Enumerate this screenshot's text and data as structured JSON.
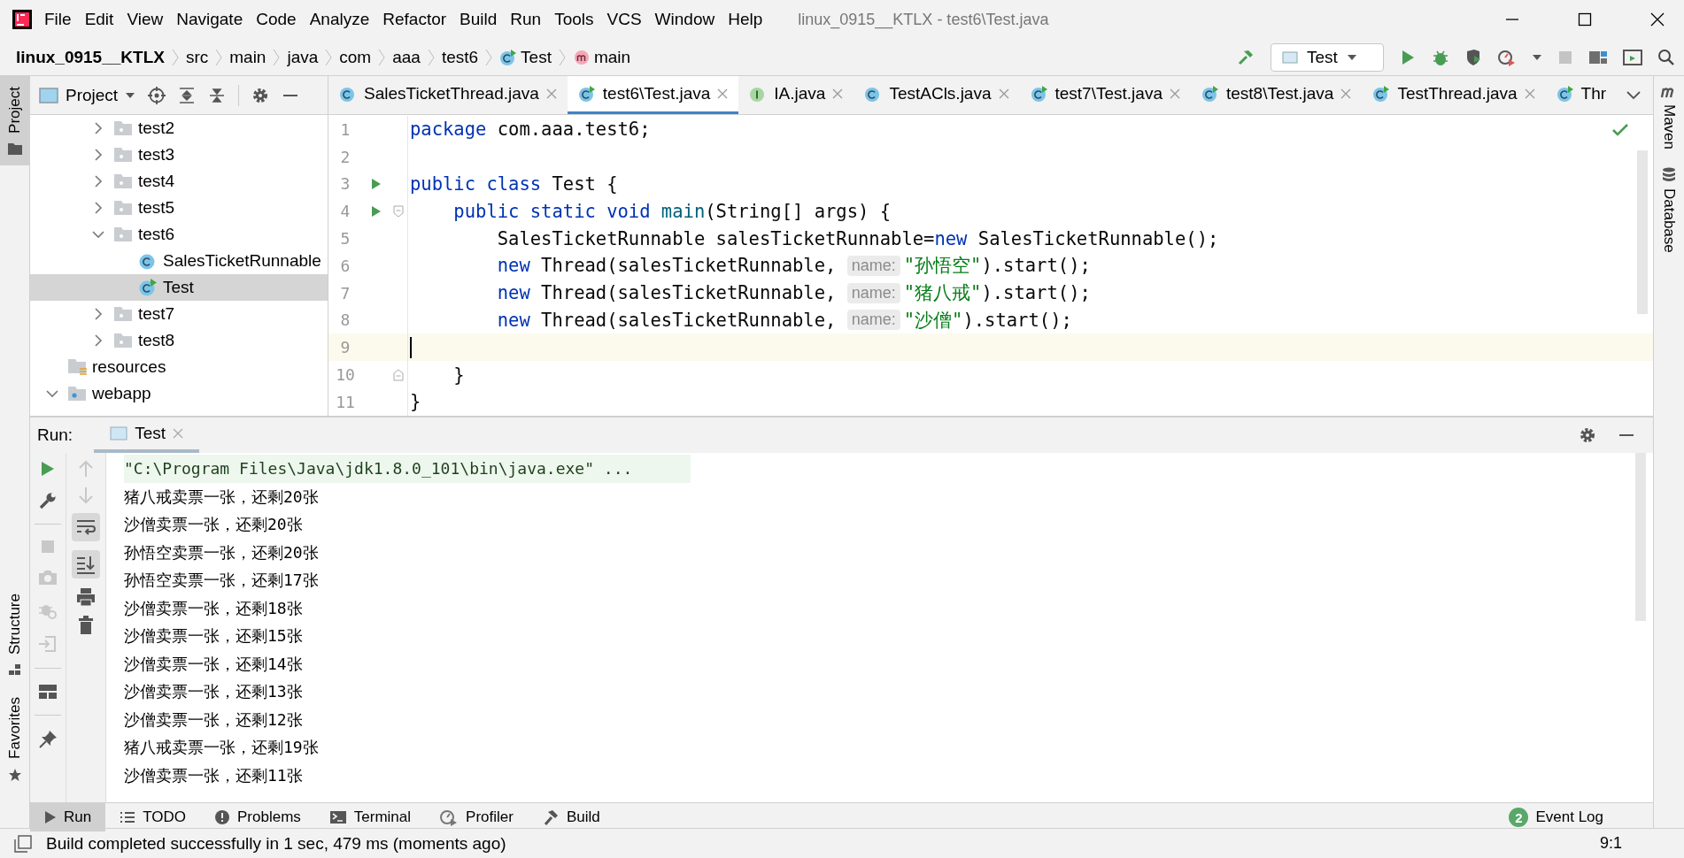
{
  "window": {
    "title": "linux_0915__KTLX - test6\\Test.java"
  },
  "menu": [
    "File",
    "Edit",
    "View",
    "Navigate",
    "Code",
    "Analyze",
    "Refactor",
    "Build",
    "Run",
    "Tools",
    "VCS",
    "Window",
    "Help"
  ],
  "breadcrumbs": [
    {
      "label": "linux_0915__KTLX",
      "kind": "project"
    },
    {
      "label": "src",
      "kind": "folder"
    },
    {
      "label": "main",
      "kind": "folder"
    },
    {
      "label": "java",
      "kind": "folder"
    },
    {
      "label": "com",
      "kind": "folder"
    },
    {
      "label": "aaa",
      "kind": "folder"
    },
    {
      "label": "test6",
      "kind": "folder"
    },
    {
      "label": "Test",
      "kind": "class"
    },
    {
      "label": "main",
      "kind": "method"
    }
  ],
  "run_config": {
    "label": "Test"
  },
  "left_stripe": [
    {
      "label": "Project",
      "kind": "project",
      "selected": true
    },
    {
      "label": "Structure",
      "kind": "structure",
      "selected": false
    },
    {
      "label": "Favorites",
      "kind": "favorites",
      "selected": false
    }
  ],
  "right_stripe": [
    {
      "label": "Maven",
      "kind": "maven"
    },
    {
      "label": "Database",
      "kind": "database"
    }
  ],
  "project": {
    "title": "Project",
    "tree": [
      {
        "children": [
          {
            "label": "test2",
            "kind": "folder",
            "expanded": false,
            "selected": false
          },
          {
            "label": "test3",
            "kind": "folder",
            "expanded": false,
            "selected": false
          },
          {
            "label": "test4",
            "kind": "folder",
            "expanded": false,
            "selected": false
          },
          {
            "label": "test5",
            "kind": "folder",
            "expanded": false,
            "selected": false
          },
          {
            "label": "test6",
            "kind": "folder",
            "expanded": true,
            "selected": false,
            "children": [
              {
                "label": "SalesTicketRunnable",
                "kind": "class",
                "selected": false
              },
              {
                "label": "Test",
                "kind": "runnable",
                "selected": true
              }
            ]
          },
          {
            "label": "test7",
            "kind": "folder",
            "expanded": false,
            "selected": false
          },
          {
            "label": "test8",
            "kind": "folder",
            "expanded": false,
            "selected": false
          }
        ]
      },
      {
        "label": "resources",
        "kind": "resources",
        "selected": false
      },
      {
        "label": "webapp",
        "kind": "webapp",
        "expanded": true,
        "selected": false
      }
    ]
  },
  "editor_tabs": [
    {
      "label": "SalesTicketThread.java",
      "kind": "class",
      "selected": false,
      "close_button": true
    },
    {
      "label": "test6\\Test.java",
      "kind": "runnable",
      "selected": true,
      "close_button": true
    },
    {
      "label": "IA.java",
      "kind": "interface",
      "selected": false,
      "close_button": true
    },
    {
      "label": "TestACls.java",
      "kind": "class",
      "selected": false,
      "close_button": true
    },
    {
      "label": "test7\\Test.java",
      "kind": "runnable",
      "selected": false,
      "close_button": true
    },
    {
      "label": "test8\\Test.java",
      "kind": "runnable",
      "selected": false,
      "close_button": true
    },
    {
      "label": "TestThread.java",
      "kind": "runnable",
      "selected": false,
      "close_button": true
    },
    {
      "label": "Thr",
      "kind": "runnable",
      "selected": false,
      "close_button": false
    }
  ],
  "code_lines": [
    {
      "number": "1",
      "segments": [
        {
          "kind": "kw",
          "text": "package"
        },
        {
          "kind": "plain",
          "text": " com.aaa.test6;"
        }
      ]
    },
    {
      "number": "2"
    },
    {
      "number": "3",
      "gutter": [
        {
          "kind": "run"
        }
      ],
      "segments": [
        {
          "kind": "kw",
          "text": "public class"
        },
        {
          "kind": "plain",
          "text": " Test {"
        }
      ]
    },
    {
      "number": "4",
      "gutter": [
        {
          "kind": "run"
        },
        {
          "kind": "fold-start"
        }
      ],
      "segments": [
        {
          "kind": "kw",
          "text": "    public static void"
        },
        {
          "kind": "fn",
          "text": " main"
        },
        {
          "kind": "plain",
          "text": "(String[] args) {"
        }
      ]
    },
    {
      "number": "5",
      "segments": [
        {
          "kind": "plain",
          "text": "        SalesTicketRunnable salesTicketRunnable="
        },
        {
          "kind": "kw",
          "text": "new"
        },
        {
          "kind": "plain",
          "text": " SalesTicketRunnable();"
        }
      ]
    },
    {
      "number": "6",
      "segments": [
        {
          "kind": "kw",
          "text": "        new"
        },
        {
          "kind": "plain",
          "text": " Thread(salesTicketRunnable, "
        },
        {
          "kind": "hint",
          "text": "name:"
        },
        {
          "kind": "str",
          "text": "\"孙悟空\""
        },
        {
          "kind": "plain",
          "text": ").start();"
        }
      ]
    },
    {
      "number": "7",
      "segments": [
        {
          "kind": "kw",
          "text": "        new"
        },
        {
          "kind": "plain",
          "text": " Thread(salesTicketRunnable, "
        },
        {
          "kind": "hint",
          "text": "name:"
        },
        {
          "kind": "str",
          "text": "\"猪八戒\""
        },
        {
          "kind": "plain",
          "text": ").start();"
        }
      ]
    },
    {
      "number": "8",
      "segments": [
        {
          "kind": "kw",
          "text": "        new"
        },
        {
          "kind": "plain",
          "text": " Thread(salesTicketRunnable, "
        },
        {
          "kind": "hint",
          "text": "name:"
        },
        {
          "kind": "str",
          "text": "\"沙僧\""
        },
        {
          "kind": "plain",
          "text": ").start();"
        }
      ]
    },
    {
      "number": "9",
      "current": true
    },
    {
      "number": "10",
      "gutter": [
        {
          "kind": "fold-end"
        }
      ],
      "segments": [
        {
          "kind": "plain",
          "text": "    }"
        }
      ]
    },
    {
      "number": "11",
      "segments": [
        {
          "kind": "plain",
          "text": "}"
        }
      ]
    }
  ],
  "run_panel": {
    "label": "Run:",
    "tab": "Test",
    "output": [
      {
        "kind": "command",
        "text": "\"C:\\Program Files\\Java\\jdk1.8.0_101\\bin\\java.exe\" ..."
      },
      {
        "kind": "plain",
        "text": "猪八戒卖票一张，还剩20张"
      },
      {
        "kind": "plain",
        "text": "沙僧卖票一张，还剩20张"
      },
      {
        "kind": "plain",
        "text": "孙悟空卖票一张，还剩20张"
      },
      {
        "kind": "plain",
        "text": "孙悟空卖票一张，还剩17张"
      },
      {
        "kind": "plain",
        "text": "沙僧卖票一张，还剩18张"
      },
      {
        "kind": "plain",
        "text": "沙僧卖票一张，还剩15张"
      },
      {
        "kind": "plain",
        "text": "沙僧卖票一张，还剩14张"
      },
      {
        "kind": "plain",
        "text": "沙僧卖票一张，还剩13张"
      },
      {
        "kind": "plain",
        "text": "沙僧卖票一张，还剩12张"
      },
      {
        "kind": "plain",
        "text": "猪八戒卖票一张，还剩19张"
      },
      {
        "kind": "plain",
        "text": "沙僧卖票一张，还剩11张"
      }
    ]
  },
  "bottom_tabs": [
    {
      "label": "Run",
      "kind": "run",
      "selected": true
    },
    {
      "label": "TODO",
      "kind": "todo",
      "selected": false
    },
    {
      "label": "Problems",
      "kind": "problems",
      "selected": false
    },
    {
      "label": "Terminal",
      "kind": "terminal",
      "selected": false
    },
    {
      "label": "Profiler",
      "kind": "profiler",
      "selected": false
    },
    {
      "label": "Build",
      "kind": "build",
      "selected": false
    }
  ],
  "event_log": {
    "label": "Event Log",
    "badge": "2"
  },
  "status_bar": {
    "message": "Build completed successfully in 1 sec, 479 ms (moments ago)",
    "position": "9:1"
  }
}
